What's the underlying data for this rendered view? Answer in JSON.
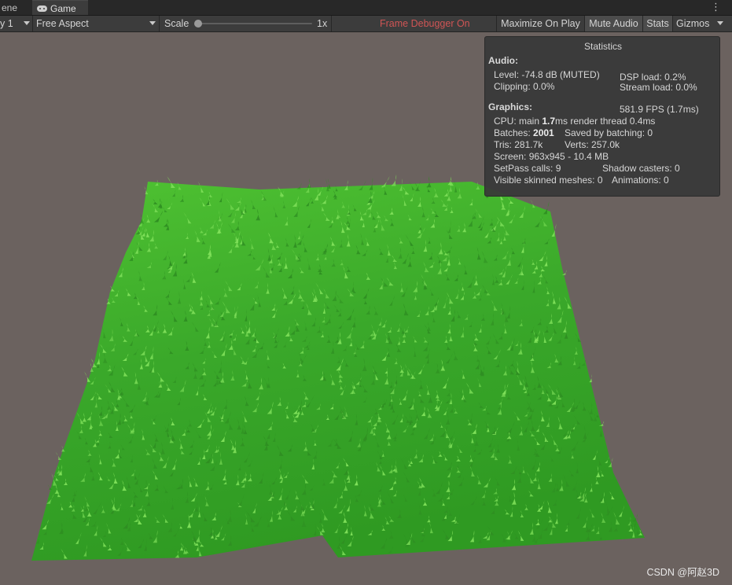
{
  "tabs": {
    "scene_label": "ene",
    "game_label": "Game"
  },
  "toolbar": {
    "display_label": "y 1",
    "aspect_label": "Free Aspect",
    "scale_label": "Scale",
    "scale_value": "1x",
    "scale_fraction": 0.0,
    "frame_debugger": "Frame Debugger On",
    "frame_debugger_color": "#d05555",
    "maximize_label": "Maximize On Play",
    "mute_label": "Mute Audio",
    "stats_label": "Stats",
    "gizmos_label": "Gizmos"
  },
  "stats": {
    "title": "Statistics",
    "audio_header": "Audio:",
    "level": "Level: -74.8 dB (MUTED)",
    "dsp_load": "DSP load: 0.2%",
    "clipping": "Clipping: 0.0%",
    "stream_load": "Stream load: 0.0%",
    "graphics_header": "Graphics:",
    "fps": "581.9 FPS (1.7ms)",
    "cpu_prefix": "CPU: main ",
    "cpu_main": "1.7",
    "cpu_suffix": "ms  render thread 0.4ms",
    "batches_prefix": "Batches: ",
    "batches_value": "2001",
    "saved_by_batching": "Saved by batching: 0",
    "tris": "Tris: 281.7k",
    "verts": "Verts: 257.0k",
    "screen": "Screen: 963x945 - 10.4 MB",
    "setpass": "SetPass calls: 9",
    "shadow_casters": "Shadow casters: 0",
    "skinned_meshes": "Visible skinned meshes: 0",
    "animations": "Animations: 0"
  },
  "colors": {
    "viewport_background": "#6b625f",
    "grass_dark": "#2f8f22",
    "grass_light": "#7fe05a"
  },
  "watermark": "CSDN @阿赵3D"
}
